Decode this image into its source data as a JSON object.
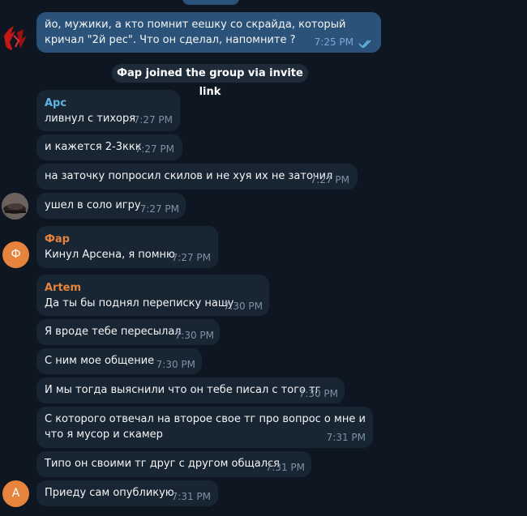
{
  "messages": {
    "m1": {
      "text": "йо, мужики, а кто помнит еешку со скрайда, который кричал \"2й рес\". Что он сделал, напомните ?",
      "time": "7:25 PM"
    },
    "service": "Фар joined the group via invite link",
    "arc": {
      "sender": "Арс",
      "sender_color": "#5fb6e6",
      "m1": {
        "text": "ливнул с тихоря",
        "time": "7:27 PM"
      },
      "m2": {
        "text": "и кажется 2-3ккк",
        "time": "7:27 PM"
      },
      "m3": {
        "text": "на заточку попросил скилов и не хуя их не заточил",
        "time": "7:27 PM"
      },
      "m4": {
        "text": "ушел в соло игру",
        "time": "7:27 PM"
      }
    },
    "far": {
      "sender": "Фар",
      "sender_color": "#e6843d",
      "avatar_letter": "Ф",
      "m1": {
        "text": "Кинул Арсена, я помню",
        "time": "7:27 PM"
      }
    },
    "artem": {
      "sender": "Artem",
      "sender_color": "#e6843d",
      "avatar_letter": "A",
      "m1": {
        "text": "Да ты бы поднял переписку нашу",
        "time": "7:30 PM"
      },
      "m2": {
        "text": "Я вроде тебе пересылал",
        "time": "7:30 PM"
      },
      "m3": {
        "text": "С ним мое общение",
        "time": "7:30 PM"
      },
      "m4": {
        "text": "И мы тогда выяснили что он тебе писал с того тг",
        "time": "7:30 PM"
      },
      "m5": {
        "text": "С которого отвечал на второе свое тг про вопрос о мне и что я мусор и скамер",
        "time": "7:31 PM"
      },
      "m6": {
        "text": "Типо он своими тг друг с другом общался",
        "time": "7:31 PM"
      },
      "m7": {
        "text": "Приеду сам опубликую",
        "time": "7:31 PM"
      }
    }
  },
  "icons": {
    "read_ticks": "double-check-icon"
  }
}
